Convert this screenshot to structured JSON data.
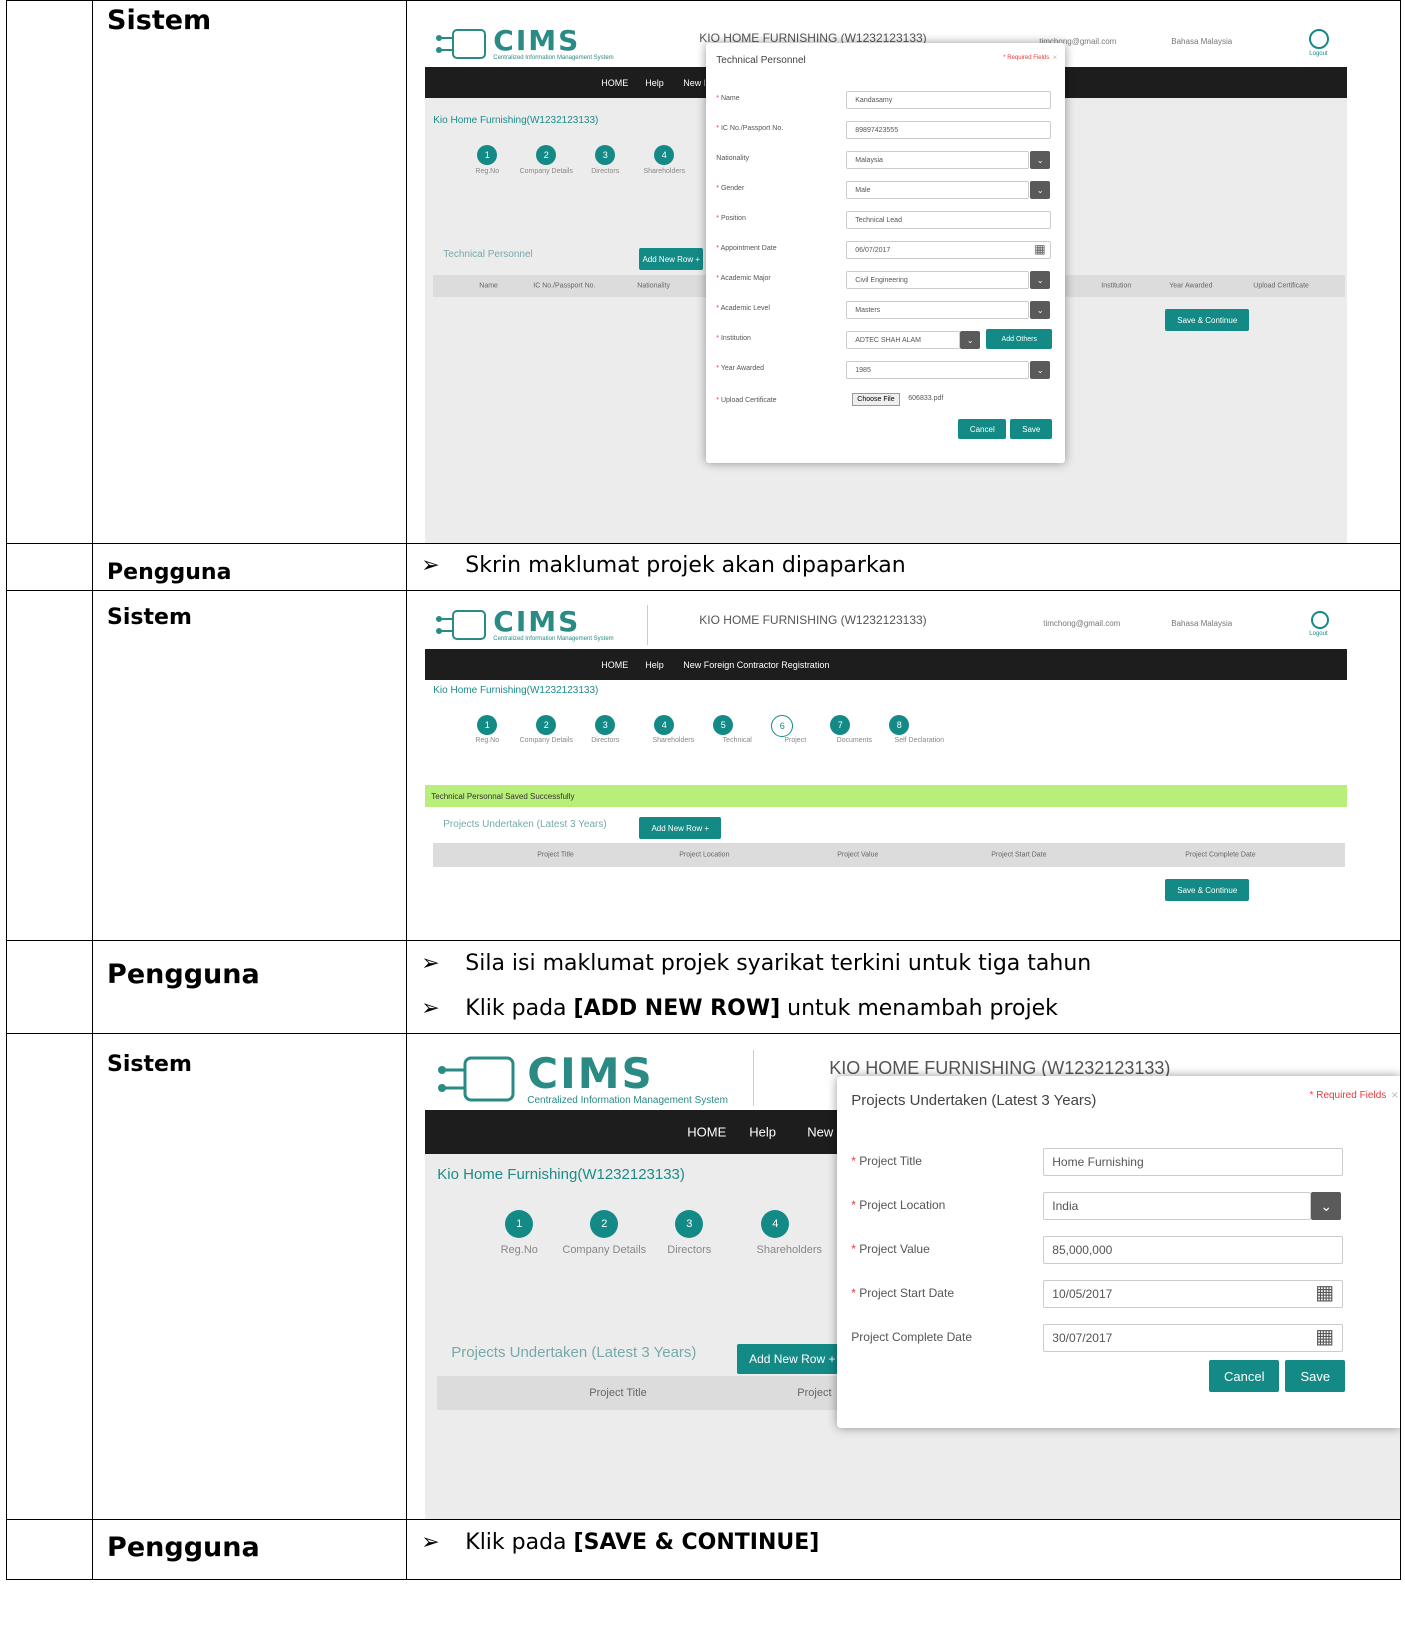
{
  "rows": [
    {
      "actor": "Sistem",
      "screen": {
        "company_title": "KIO HOME FURNISHING (W1232123133)",
        "account_email": "timchong@gmail.com",
        "language": "Bahasa Malaysia",
        "logout_label": "Logout",
        "logo_text": "CIMS",
        "logo_sub": "Centralized Information Management System",
        "nav": [
          "HOME",
          "Help",
          "New Foreign Contractor Registration"
        ],
        "company_breadcrumb": "Kio Home Furnishing(W1232123133)",
        "steps": [
          {
            "num": "1",
            "label": "Reg.No"
          },
          {
            "num": "2",
            "label": "Company Details"
          },
          {
            "num": "3",
            "label": "Directors"
          },
          {
            "num": "4",
            "label": "Shareholders"
          }
        ],
        "section_title": "Technical Personnel",
        "add_row_label": "Add New Row +",
        "columns_left": [
          "Name",
          "IC No./Passport No.",
          "Nationality"
        ],
        "columns_right": [
          "Institution",
          "Year Awarded",
          "Upload Certificate"
        ],
        "save_continue": "Save & Continue",
        "modal": {
          "title": "Technical Personnel",
          "required": "* Required Fields",
          "fields": [
            {
              "label": "Name",
              "required": true,
              "value": "Kandasamy",
              "kind": "text"
            },
            {
              "label": "IC No./Passport No.",
              "required": true,
              "value": "89897423555",
              "kind": "text"
            },
            {
              "label": "Nationality",
              "required": false,
              "value": "Malaysia",
              "kind": "select"
            },
            {
              "label": "Gender",
              "required": true,
              "value": "Male",
              "kind": "select"
            },
            {
              "label": "Position",
              "required": true,
              "value": "Technical Lead",
              "kind": "text"
            },
            {
              "label": "Appointment Date",
              "required": true,
              "value": "06/07/2017",
              "kind": "date"
            },
            {
              "label": "Academic Major",
              "required": true,
              "value": "Civil Engineering",
              "kind": "select"
            },
            {
              "label": "Academic Level",
              "required": true,
              "value": "Masters",
              "kind": "select"
            },
            {
              "label": "Institution",
              "required": true,
              "value": "ADTEC SHAH ALAM",
              "kind": "select-add"
            },
            {
              "label": "Year Awarded",
              "required": true,
              "value": "1985",
              "kind": "select"
            },
            {
              "label": "Upload Certificate",
              "required": true,
              "value": "606833.pdf",
              "kind": "file"
            }
          ],
          "add_others": "Add Others",
          "choose_file": "Choose File",
          "cancel": "Cancel",
          "save": "Save"
        }
      }
    },
    {
      "actor": "Pengguna",
      "bullets": [
        [
          "",
          "Skrin maklumat projek akan dipaparkan",
          ""
        ]
      ]
    },
    {
      "actor": "Sistem",
      "screen": {
        "company_title": "KIO HOME FURNISHING (W1232123133)",
        "account_email": "timchong@gmail.com",
        "language": "Bahasa Malaysia",
        "logout_label": "Logout",
        "nav": [
          "HOME",
          "Help",
          "New Foreign Contractor Registration"
        ],
        "company_breadcrumb": "Kio Home Furnishing(W1232123133)",
        "steps": [
          {
            "num": "1",
            "label": "Reg.No"
          },
          {
            "num": "2",
            "label": "Company Details"
          },
          {
            "num": "3",
            "label": "Directors"
          },
          {
            "num": "4",
            "label": "Shareholders"
          },
          {
            "num": "5",
            "label": "Technical"
          },
          {
            "num": "6",
            "label": "Project"
          },
          {
            "num": "7",
            "label": "Documents"
          },
          {
            "num": "8",
            "label": "Self Declaration"
          }
        ],
        "success_msg": "Technical Personnal Saved Successfully",
        "section_title": "Projects Undertaken (Latest 3 Years)",
        "add_row_label": "Add New Row +",
        "columns": [
          "Project Title",
          "Project Location",
          "Project Value",
          "Project Start Date",
          "Project Complete Date"
        ],
        "save_continue": "Save & Continue"
      }
    },
    {
      "actor": "Pengguna",
      "bullets": [
        [
          "",
          "Sila isi maklumat projek syarikat terkini untuk tiga tahun",
          ""
        ],
        [
          "Klik pada ",
          "[ADD NEW ROW]",
          " untuk menambah projek"
        ]
      ]
    },
    {
      "actor": "Sistem",
      "screen": {
        "company_title": "KIO HOME FURNISHING (W1232123133)",
        "nav": [
          "HOME",
          "Help",
          "New"
        ],
        "company_breadcrumb": "Kio Home Furnishing(W1232123133)",
        "steps": [
          {
            "num": "1",
            "label": "Reg.No"
          },
          {
            "num": "2",
            "label": "Company Details"
          },
          {
            "num": "3",
            "label": "Directors"
          },
          {
            "num": "4",
            "label": "Shareholders"
          }
        ],
        "section_title": "Projects Undertaken (Latest 3 Years)",
        "add_row_label": "Add New Row +",
        "columns": [
          "Project Title",
          "Project"
        ],
        "modal": {
          "title": "Projects Undertaken (Latest 3 Years)",
          "required": "* Required Fields",
          "fields": [
            {
              "label": "Project Title",
              "required": true,
              "value": "Home Furnishing",
              "kind": "text"
            },
            {
              "label": "Project Location",
              "required": true,
              "value": "India",
              "kind": "select"
            },
            {
              "label": "Project Value",
              "required": true,
              "value": "85,000,000",
              "kind": "text"
            },
            {
              "label": "Project Start Date",
              "required": true,
              "value": "10/05/2017",
              "kind": "date"
            },
            {
              "label": "Project Complete Date",
              "required": false,
              "value": "30/07/2017",
              "kind": "date"
            }
          ],
          "cancel": "Cancel",
          "save": "Save"
        }
      }
    },
    {
      "actor": "Pengguna",
      "bullets": [
        [
          "Klik pada ",
          "[SAVE & CONTINUE]",
          ""
        ]
      ]
    }
  ],
  "bullet_glyph": "➢",
  "colors": {
    "accent": "#148a86",
    "nav_bg": "#1d1d1d",
    "success_bg": "#b7ef7a",
    "required": "#e43c3c"
  }
}
